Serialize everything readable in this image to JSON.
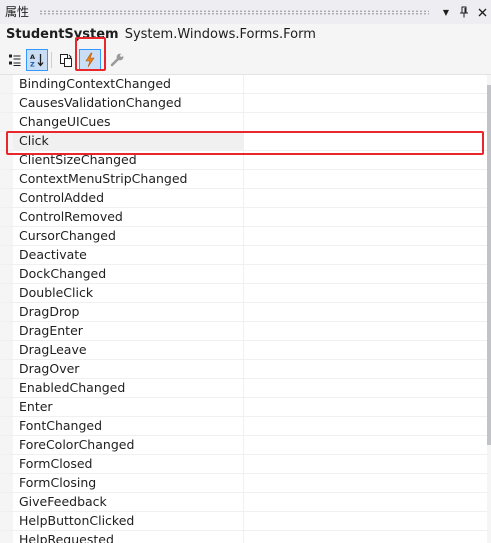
{
  "window": {
    "title": "属性",
    "dropdown_glyph": "▼",
    "pin_glyph": "⊥",
    "close_glyph": "✕"
  },
  "object_selector": {
    "name": "StudentSystem",
    "type": "System.Windows.Forms.Form"
  },
  "toolbar": {
    "buttons": [
      {
        "name": "categorized-button",
        "icon": "categorized-icon",
        "selected": false
      },
      {
        "name": "alphabetical-button",
        "icon": "sort-az-icon",
        "selected": true
      },
      {
        "name": "properties-button",
        "icon": "property-pages-icon",
        "selected": false
      },
      {
        "name": "events-button",
        "icon": "lightning-icon",
        "selected": true
      },
      {
        "name": "property-pages-button",
        "icon": "wrench-icon",
        "selected": false
      }
    ]
  },
  "events": [
    {
      "name": "BindingContextChanged",
      "value": ""
    },
    {
      "name": "CausesValidationChanged",
      "value": ""
    },
    {
      "name": "ChangeUICues",
      "value": ""
    },
    {
      "name": "Click",
      "value": "",
      "selected": true
    },
    {
      "name": "ClientSizeChanged",
      "value": ""
    },
    {
      "name": "ContextMenuStripChanged",
      "value": ""
    },
    {
      "name": "ControlAdded",
      "value": ""
    },
    {
      "name": "ControlRemoved",
      "value": ""
    },
    {
      "name": "CursorChanged",
      "value": ""
    },
    {
      "name": "Deactivate",
      "value": ""
    },
    {
      "name": "DockChanged",
      "value": ""
    },
    {
      "name": "DoubleClick",
      "value": ""
    },
    {
      "name": "DragDrop",
      "value": ""
    },
    {
      "name": "DragEnter",
      "value": ""
    },
    {
      "name": "DragLeave",
      "value": ""
    },
    {
      "name": "DragOver",
      "value": ""
    },
    {
      "name": "EnabledChanged",
      "value": ""
    },
    {
      "name": "Enter",
      "value": ""
    },
    {
      "name": "FontChanged",
      "value": ""
    },
    {
      "name": "ForeColorChanged",
      "value": ""
    },
    {
      "name": "FormClosed",
      "value": ""
    },
    {
      "name": "FormClosing",
      "value": ""
    },
    {
      "name": "GiveFeedback",
      "value": ""
    },
    {
      "name": "HelpButtonClicked",
      "value": ""
    },
    {
      "name": "HelpRequested",
      "value": ""
    }
  ],
  "colors": {
    "highlight_red": "#e8262b",
    "event_icon_orange": "#e8841a",
    "selected_button_bg": "#c9def5",
    "selected_button_border": "#3399ff"
  }
}
